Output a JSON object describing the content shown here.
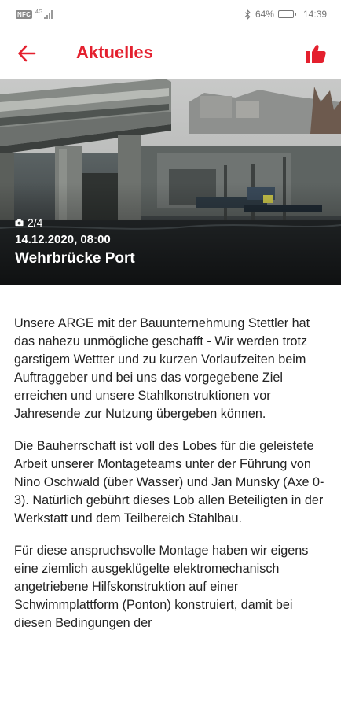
{
  "status_bar": {
    "sim_label": "NFC",
    "network_label": "4G",
    "battery_percent": "64%",
    "battery_level": 0.64,
    "time": "14:39",
    "icons": [
      "sim-icon",
      "signal-icon",
      "bluetooth-icon",
      "battery-icon"
    ]
  },
  "app_bar": {
    "title": "Aktuelles",
    "back_icon": "arrow-left-icon",
    "like_icon": "thumbs-up-icon",
    "accent_color": "#e4202e"
  },
  "hero": {
    "image_counter": "2/4",
    "date": "14.12.2020, 08:00",
    "title": "Wehrbrücke Port",
    "counter_icon": "camera-icon"
  },
  "article": {
    "paragraphs": [
      "Unsere ARGE mit der Bauunternehmung Stettler hat das nahezu unmögliche geschafft - Wir werden trotz garstigem Wettter und zu kurzen Vorlaufzeiten beim Auftraggeber und bei uns das vorgegebene Ziel erreichen und unsere Stahlkonstruktionen vor Jahresende zur Nutzung übergeben können.",
      "Die Bauherrschaft ist voll des Lobes für die geleistete Arbeit unserer Montageteams unter der Führung von Nino Oschwald (über Wasser) und Jan Munsky (Axe 0-3). Natürlich gebührt dieses Lob allen Beteiligten in der Werkstatt und dem Teilbereich Stahlbau.",
      "Für diese anspruchsvolle Montage haben wir eigens eine ziemlich ausgeklügelte elektromechanisch angetriebene Hilfskonstruktion auf einer Schwimmplattform (Ponton) konstruiert, damit bei diesen Bedingungen der"
    ]
  }
}
